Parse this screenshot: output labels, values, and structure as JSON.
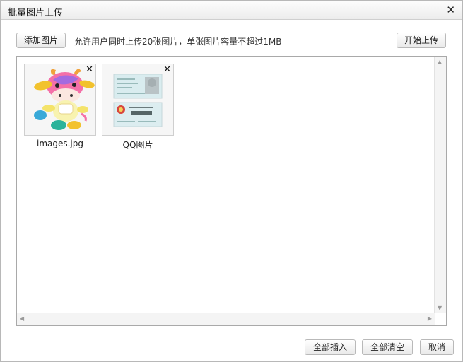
{
  "dialog": {
    "title": "批量图片上传",
    "close_icon": "✕"
  },
  "toolbar": {
    "add_label": "添加图片",
    "hint": "允许用户同时上传20张图片，单张图片容量不超过1MB",
    "start_label": "开始上传"
  },
  "files": [
    {
      "name": "images.jpg",
      "remove_icon": "✕"
    },
    {
      "name": "QQ图片",
      "remove_icon": "✕"
    }
  ],
  "footer": {
    "insert_all": "全部插入",
    "clear_all": "全部清空",
    "cancel": "取消"
  }
}
